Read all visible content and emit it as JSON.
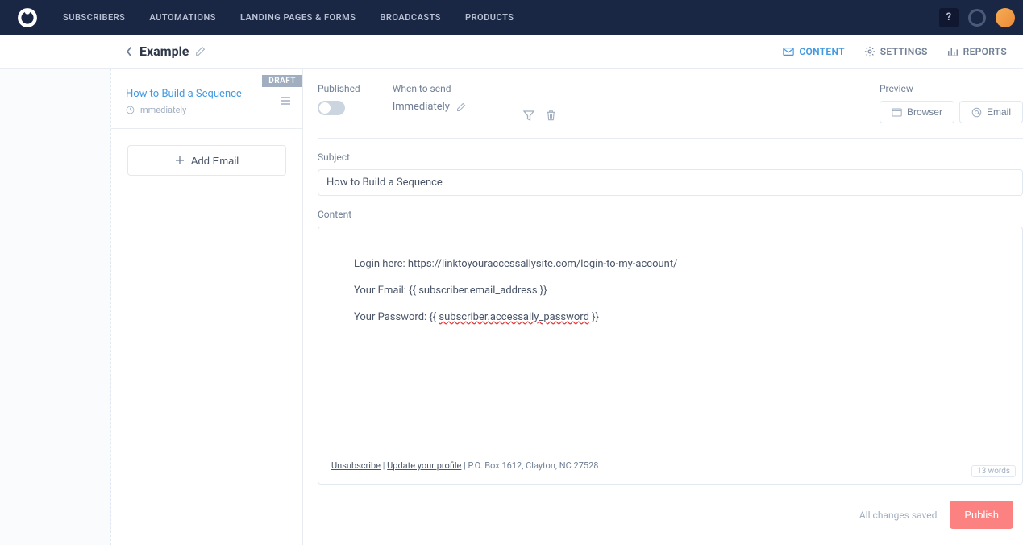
{
  "nav": {
    "items": [
      "SUBSCRIBERS",
      "AUTOMATIONS",
      "LANDING PAGES & FORMS",
      "BROADCASTS",
      "PRODUCTS"
    ],
    "help": "?"
  },
  "subheader": {
    "title": "Example",
    "tabs": [
      {
        "label": "CONTENT",
        "active": true
      },
      {
        "label": "SETTINGS",
        "active": false
      },
      {
        "label": "REPORTS",
        "active": false
      }
    ]
  },
  "sidebar": {
    "draft_badge": "DRAFT",
    "email": {
      "title": "How to Build a Sequence",
      "timing": "Immediately"
    },
    "add_email": "Add Email"
  },
  "editor": {
    "published_label": "Published",
    "when_label": "When to send",
    "when_value": "Immediately",
    "preview_label": "Preview",
    "preview_browser": "Browser",
    "preview_email": "Email",
    "subject_label": "Subject",
    "subject_value": "How to Build a Sequence",
    "content_label": "Content",
    "body": {
      "login_prefix": "Login here: ",
      "login_link": "https://linktoyouraccessallysite.com/login-to-my-account/",
      "email_line_prefix": "Your Email: ",
      "email_token": "{{ subscriber.email_address }}",
      "password_prefix": "Your Password: {{ ",
      "password_token": "subscriber.accessally_password",
      "password_suffix": " }}"
    },
    "footer": {
      "unsubscribe": "Unsubscribe",
      "update": "Update your profile",
      "address": "P.O. Box 1612, Clayton, NC 27528"
    },
    "word_count": "13 words",
    "save_status": "All changes saved",
    "publish": "Publish"
  }
}
